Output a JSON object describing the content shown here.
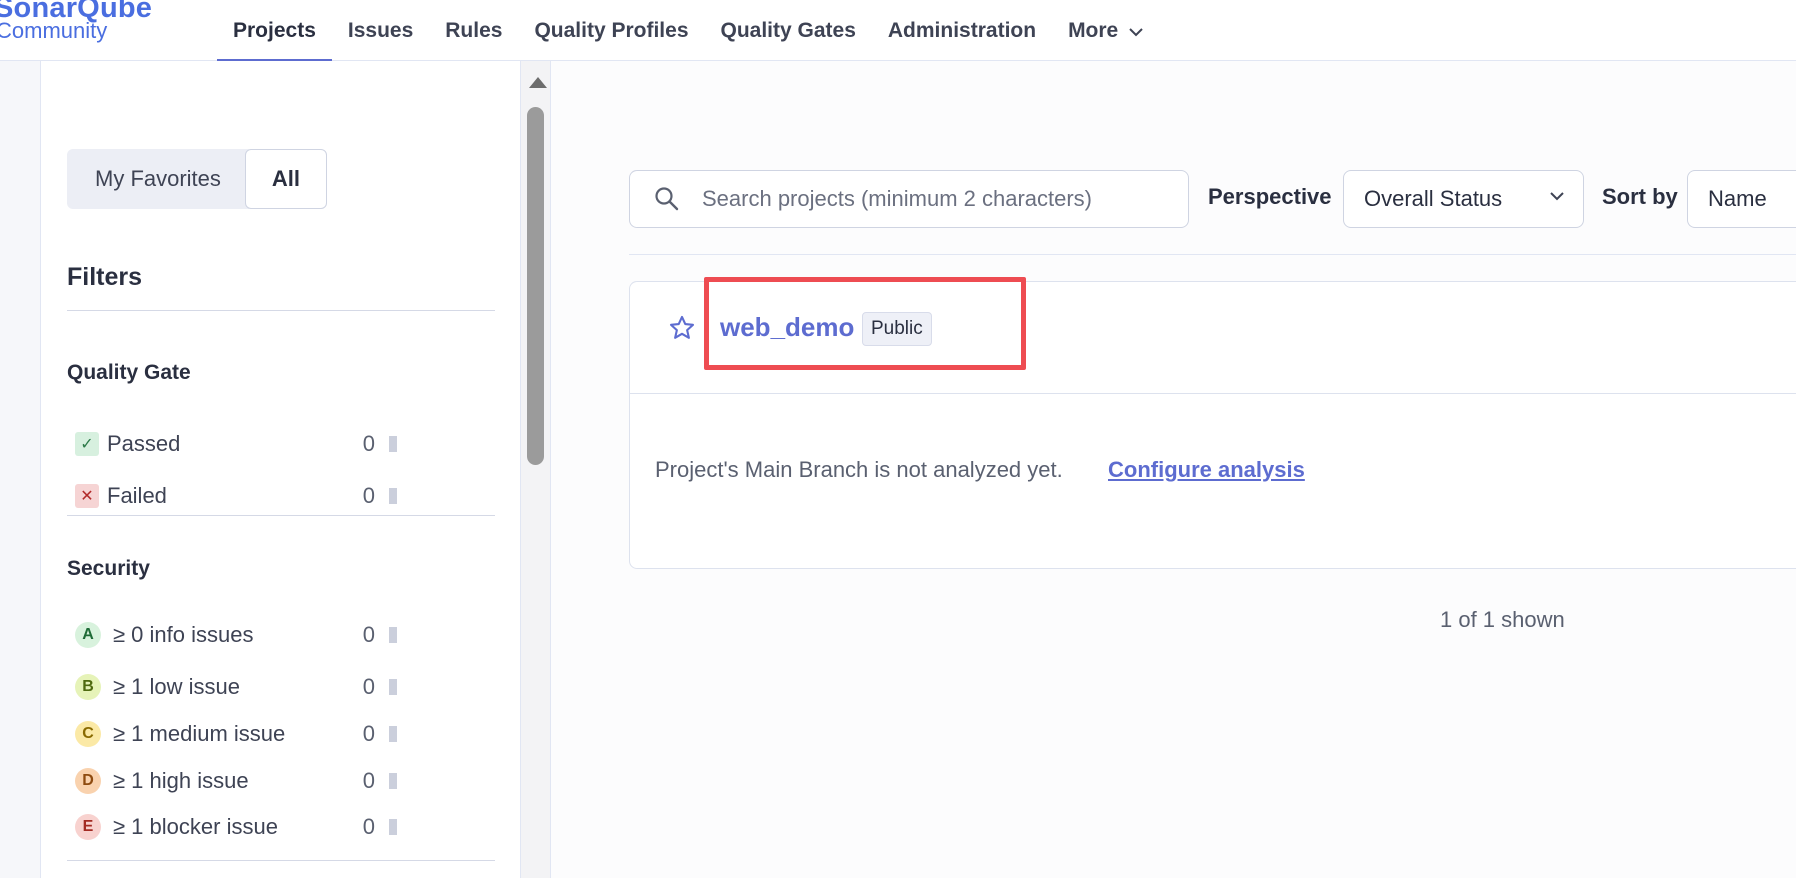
{
  "header": {
    "logo_main": "SonarQube",
    "logo_sub": "Community",
    "nav": [
      {
        "label": "Projects",
        "active": true
      },
      {
        "label": "Issues"
      },
      {
        "label": "Rules"
      },
      {
        "label": "Quality Profiles"
      },
      {
        "label": "Quality Gates"
      },
      {
        "label": "Administration"
      },
      {
        "label": "More"
      }
    ]
  },
  "sidebar": {
    "favorites_label": "My Favorites",
    "all_label": "All",
    "filters_title": "Filters",
    "quality_gate": {
      "title": "Quality Gate",
      "items": [
        {
          "label": "Passed",
          "count": "0",
          "icon": "check-icon"
        },
        {
          "label": "Failed",
          "count": "0",
          "icon": "cross-icon"
        }
      ]
    },
    "security": {
      "title": "Security",
      "items": [
        {
          "rating": "A",
          "label": "≥ 0 info issues",
          "count": "0"
        },
        {
          "rating": "B",
          "label": "≥ 1 low issue",
          "count": "0"
        },
        {
          "rating": "C",
          "label": "≥ 1 medium issue",
          "count": "0"
        },
        {
          "rating": "D",
          "label": "≥ 1 high issue",
          "count": "0"
        },
        {
          "rating": "E",
          "label": "≥ 1 blocker issue",
          "count": "0"
        }
      ]
    }
  },
  "main": {
    "search_placeholder": "Search projects (minimum 2 characters)",
    "perspective_label": "Perspective",
    "perspective_value": "Overall Status",
    "sort_label": "Sort by",
    "sort_value": "Name",
    "project": {
      "name": "web_demo",
      "visibility": "Public",
      "message": "Project's Main Branch is not analyzed yet.",
      "link": "Configure analysis"
    },
    "shown_count": "1 of 1 shown"
  },
  "colors": {
    "accent": "#5d6cd0",
    "highlight": "#ee4c52"
  }
}
